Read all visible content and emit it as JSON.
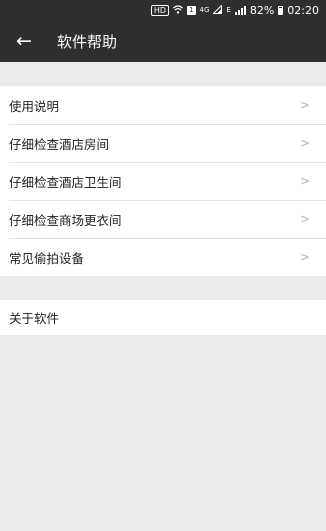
{
  "status_bar": {
    "hd": "HD",
    "sim": "1",
    "network": "4G",
    "network_b": "E",
    "battery": "82%",
    "time": "02:20"
  },
  "app_bar": {
    "back_icon": "←",
    "title": "软件帮助"
  },
  "menu": {
    "items": [
      {
        "label": "使用说明",
        "chevron": ">"
      },
      {
        "label": "仔细检查酒店房间",
        "chevron": ">"
      },
      {
        "label": "仔细检查酒店卫生间",
        "chevron": ">"
      },
      {
        "label": "仔细检查商场更衣间",
        "chevron": ">"
      },
      {
        "label": "常见偷拍设备",
        "chevron": ">"
      }
    ]
  },
  "about": {
    "label": "关于软件"
  },
  "colors": {
    "toolbar": "#2f2f2f",
    "background": "#ececec",
    "list_background": "#ffffff",
    "chevron": "#b5b5b5"
  }
}
